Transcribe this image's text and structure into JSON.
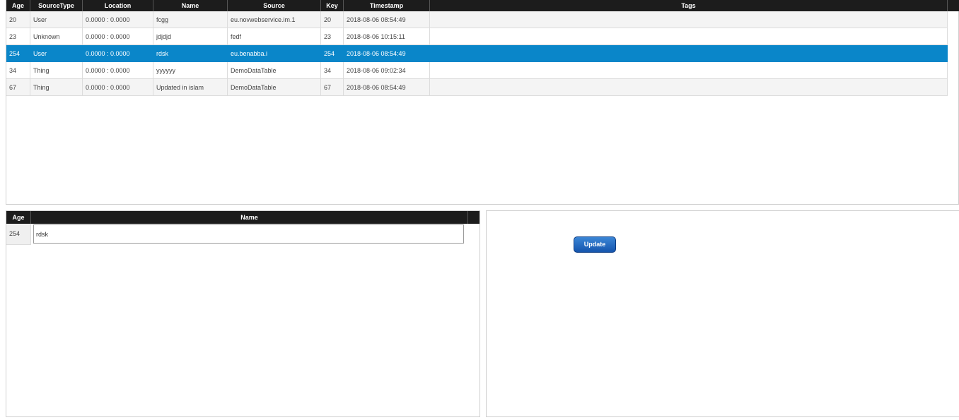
{
  "grid": {
    "columns": [
      "Age",
      "SourceType",
      "Location",
      "Name",
      "Source",
      "Key",
      "Timestamp",
      "Tags"
    ],
    "rows": [
      {
        "age": "20",
        "source_type": "User",
        "location": "0.0000 : 0.0000",
        "name": "fcgg",
        "source": "eu.novwebservice.im.1",
        "key": "20",
        "timestamp": "2018-08-06 08:54:49",
        "tags": ""
      },
      {
        "age": "23",
        "source_type": "Unknown",
        "location": "0.0000 : 0.0000",
        "name": "jdjdjd",
        "source": "fedf",
        "key": "23",
        "timestamp": "2018-08-06 10:15:11",
        "tags": ""
      },
      {
        "age": "254",
        "source_type": "User",
        "location": "0.0000 : 0.0000",
        "name": "rdsk",
        "source": "eu.benabba.i",
        "key": "254",
        "timestamp": "2018-08-06 08:54:49",
        "tags": ""
      },
      {
        "age": "34",
        "source_type": "Thing",
        "location": "0.0000 : 0.0000",
        "name": "yyyyyy",
        "source": "DemoDataTable",
        "key": "34",
        "timestamp": "2018-08-06 09:02:34",
        "tags": ""
      },
      {
        "age": "67",
        "source_type": "Thing",
        "location": "0.0000 : 0.0000",
        "name": "Updated in islam",
        "source": "DemoDataTable",
        "key": "67",
        "timestamp": "2018-08-06 08:54:49",
        "tags": ""
      }
    ],
    "selected_row": 2
  },
  "detail": {
    "columns": [
      "Age",
      "Name"
    ],
    "age": "254",
    "name_value": "rdsk"
  },
  "actions": {
    "update_label": "Update"
  },
  "colors": {
    "header_bg": "#1c1c1c",
    "selected_row": "#0a86c9",
    "button": "#1f63b8"
  }
}
